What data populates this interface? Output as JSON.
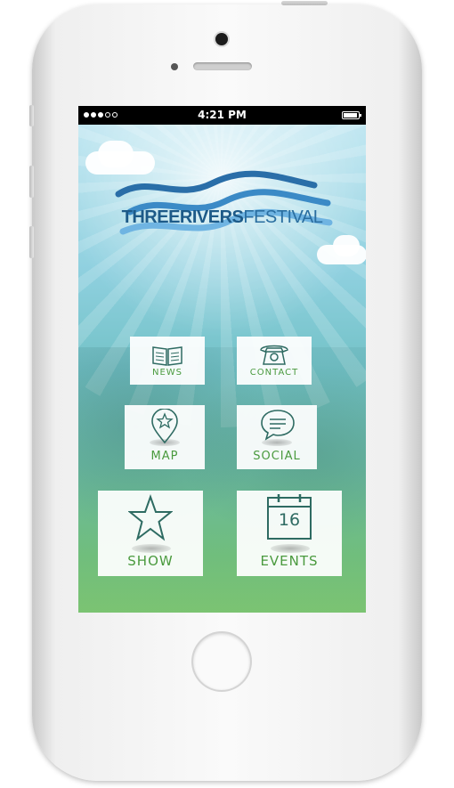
{
  "statusbar": {
    "time": "4:21 PM",
    "signal_bars_filled": 3,
    "signal_bars_total": 5,
    "battery_level": 0.95
  },
  "logo": {
    "part_bold": "THREERIVERS",
    "part_light": "FESTIVAL"
  },
  "tiles": [
    {
      "label": "NEWS",
      "icon": "book-icon"
    },
    {
      "label": "CONTACT",
      "icon": "telephone-icon"
    },
    {
      "label": "MAP",
      "icon": "map-pin-star-icon"
    },
    {
      "label": "SOCIAL",
      "icon": "speech-bubble-icon"
    },
    {
      "label": "SHOW",
      "icon": "star-icon"
    },
    {
      "label": "EVENTS",
      "icon": "calendar-icon",
      "badge": "16"
    }
  ],
  "colors": {
    "accent_green": "#4a9a3e",
    "logo_blue": "#1d5a88",
    "icon_teal": "#2e6b62"
  }
}
